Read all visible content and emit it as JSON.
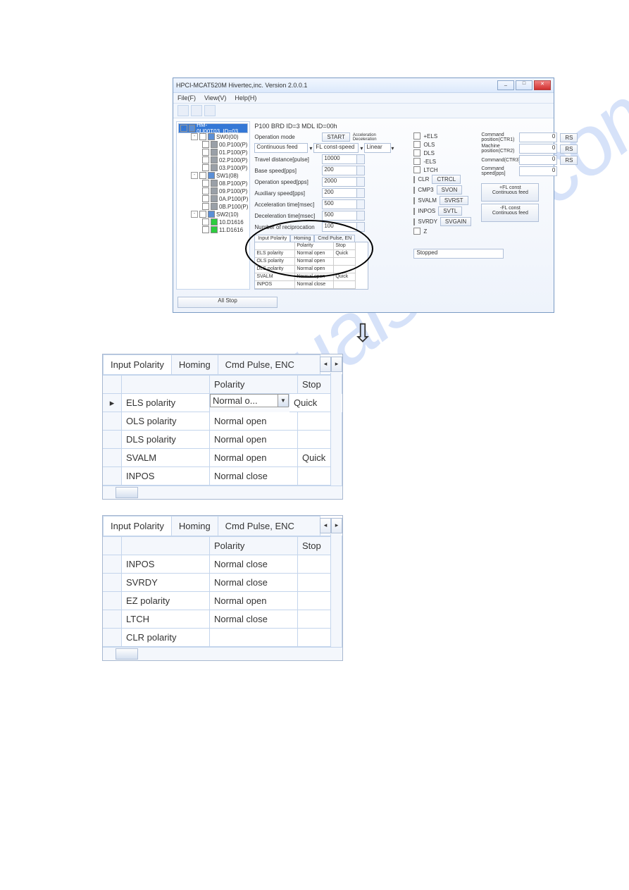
{
  "watermark": "manualshive.com",
  "window": {
    "title": "HPCI-MCAT520M Hivertec,inc. Version 2.0.0.1",
    "menu": [
      "File(F)",
      "View(V)",
      "Help(H)"
    ]
  },
  "tree": {
    "root": "HM-0U00T03_ID=03",
    "g0": "SW0(00)",
    "g0_items": [
      "00.P100(P)",
      "01.P100(P)",
      "02.P100(P)",
      "03.P100(P)"
    ],
    "g1": "SW1(08)",
    "g1_items": [
      "08.P100(P)",
      "09.P100(P)",
      "0A.P100(P)",
      "0B.P100(P)"
    ],
    "g2": "SW2(10)",
    "g2_items": [
      "10.D1616",
      "11.D1616"
    ]
  },
  "main": {
    "header": "P100 BRD ID=3 MDL ID=00h",
    "op_mode": "Operation mode",
    "start": "START",
    "accel": "Acceleration\nDeceleration",
    "cont_feed": "Continuous feed",
    "fl_const": "FL const-speed",
    "linear": "Linear",
    "travel": "Travel distance[pulse]",
    "travel_v": "10000",
    "base": "Base speed[pps]",
    "base_v": "200",
    "opspeed": "Operation speed[pps]",
    "opspeed_v": "2000",
    "aux": "Auxiliary speed[pps]",
    "aux_v": "200",
    "atime": "Acceleration time[msec]",
    "atime_v": "500",
    "dtime": "Deceleration time[msec]",
    "dtime_v": "500",
    "recip": "Number of reciprocation",
    "recip_v": "100"
  },
  "tabs1": [
    "Input Polarity",
    "Homing",
    "Cmd Pulse, EN"
  ],
  "grid1_h": [
    "",
    "Polarity",
    "Stop"
  ],
  "grid1": [
    [
      "ELS polarity",
      "Normal open",
      "Quick"
    ],
    [
      "OLS polarity",
      "Normal open",
      ""
    ],
    [
      "DLS polarity",
      "Normal open",
      ""
    ],
    [
      "SVALM",
      "Normal open",
      "Quick"
    ],
    [
      "INPOS",
      "Normal close",
      ""
    ]
  ],
  "status_items": [
    "+ELS",
    "OLS",
    "DLS",
    "-ELS",
    "LTCH",
    "CLR",
    "CMP3",
    "SVALM",
    "INPOS",
    "SVRDY",
    "Z"
  ],
  "status_btns": [
    "CTRCL",
    "SVON",
    "SVRST",
    "SVTL",
    "SVGAIN"
  ],
  "right_labels": [
    "Command\nposition(CTR1)",
    "Machine\nposition(CTR2)",
    "Command(CTR3)",
    "Command\nspeed[pps]"
  ],
  "right_vals": [
    "0",
    "0",
    "0",
    "0"
  ],
  "rs": "RS",
  "big_btns": [
    "+FL const\nContinuous feed",
    "-FL const\nContinuous feed"
  ],
  "stopped": "Stopped",
  "all_stop": "All Stop",
  "panel1": {
    "tabs": [
      "Input Polarity",
      "Homing",
      "Cmd Pulse, ENC"
    ],
    "h": [
      "",
      "Polarity",
      "Stop"
    ],
    "rows": [
      [
        "▸",
        "ELS polarity",
        "Normal o...",
        "Quick"
      ],
      [
        "",
        "OLS polarity",
        "Normal open",
        ""
      ],
      [
        "",
        "DLS polarity",
        "Normal open",
        ""
      ],
      [
        "",
        "SVALM",
        "Normal open",
        "Quick"
      ],
      [
        "",
        "INPOS",
        "Normal close",
        ""
      ]
    ]
  },
  "panel2": {
    "tabs": [
      "Input Polarity",
      "Homing",
      "Cmd Pulse, ENC"
    ],
    "h": [
      "",
      "Polarity",
      "Stop"
    ],
    "rows": [
      [
        "",
        "INPOS",
        "Normal close",
        ""
      ],
      [
        "",
        "SVRDY",
        "Normal close",
        ""
      ],
      [
        "",
        "EZ polarity",
        "Normal open",
        ""
      ],
      [
        "",
        "LTCH",
        "Normal close",
        ""
      ],
      [
        "",
        "CLR polarity",
        "",
        ""
      ]
    ]
  }
}
